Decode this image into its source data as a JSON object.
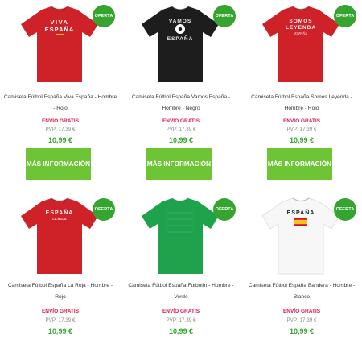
{
  "products": [
    {
      "badge": "OFERTA",
      "title": "Camiseta Fútbol España Viva España - Hombre - Rojo",
      "shipping": "ENVÍO GRATIS",
      "pvp": "PVP: 17,39 €",
      "price": "10,99 €",
      "button": "MÁS INFORMACIÓN",
      "shirt_color": "#cf2128",
      "print_lines": [
        "VIVA",
        "ESPAÑA"
      ],
      "print_color": "#ffffff"
    },
    {
      "badge": "OFERTA",
      "title": "Camiseta Fútbol España Vamos España - Hombre - Negro",
      "shipping": "ENVÍO GRATIS",
      "pvp": "PVP: 17,39 €",
      "price": "10,99 €",
      "button": "MÁS INFORMACIÓN",
      "shirt_color": "#1d1d1d",
      "print_lines": [
        "VAMOS",
        "ESPAÑA"
      ],
      "print_color": "#e8e8e8"
    },
    {
      "badge": "OFERTA",
      "title": "Camiseta Fútbol España Somos Leyenda - Hombre - Rojo",
      "shipping": "ENVÍO GRATIS",
      "pvp": "PVP: 17,39 €",
      "price": "10,99 €",
      "button": "MÁS INFORMACIÓN",
      "shirt_color": "#cf2128",
      "print_lines": [
        "SOMOS",
        "LEYENDA",
        "ESPAÑA"
      ],
      "print_color": "#f2f2f2"
    },
    {
      "badge": "OFERTA",
      "title": "Camiseta Fútbol España La Roja - Hombre - Rojo",
      "shipping": "ENVÍO GRATIS",
      "pvp": "PVP: 17,39 €",
      "price": "10,99 €",
      "button": "",
      "shirt_color": "#cf2128",
      "print_lines": [
        "ESPAÑA",
        "LA ROJA"
      ],
      "print_color": "#f5f5f5"
    },
    {
      "badge": "OFERTA",
      "title": "Camiseta Fútbol España Futbolín - Hombre - Verde",
      "shipping": "ENVÍO GRATIS",
      "pvp": "PVP: 17,39 €",
      "price": "10,99 €",
      "button": "",
      "shirt_color": "#1fa24c",
      "print_lines": [],
      "print_color": "#ffffff"
    },
    {
      "badge": "OFERTA",
      "title": "Camiseta Fútbol España Bandera - Hombre - Blanco",
      "shipping": "ENVÍO GRATIS",
      "pvp": "PVP: 17,39 €",
      "price": "10,99 €",
      "button": "",
      "shirt_color": "#f7f7f7",
      "print_lines": [
        "ESPAÑA"
      ],
      "print_color": "#222222"
    }
  ]
}
